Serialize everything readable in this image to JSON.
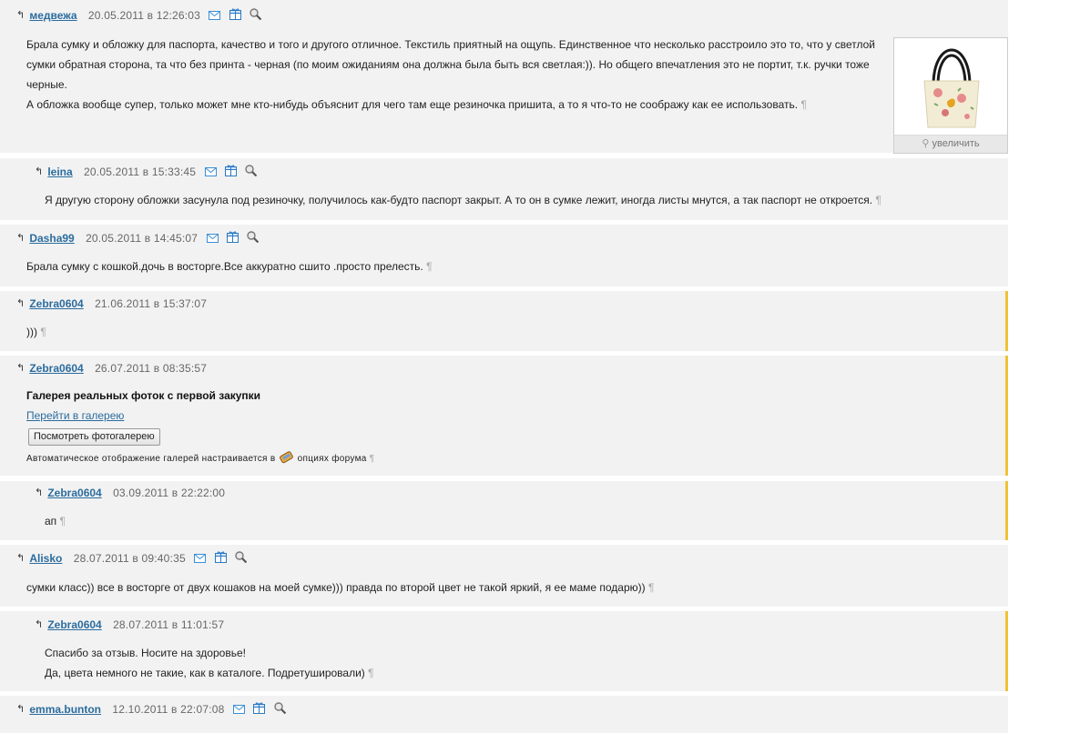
{
  "posts": [
    {
      "author": "медвежа",
      "date": "20.05.2011 в 12:26:03",
      "lines": [
        "Брала сумку и обложку для паспорта, качество и того и другого отличное. Текстиль приятный на ощупь. Единственное что несколько расстроило это то, что у светлой",
        "сумки обратная сторона, та что без принта - черная (по моим ожиданиям она должна была быть вся светлая:)). Но общего впечатления это не портит, т.к. ручки тоже",
        "черные.",
        "А обложка вообще супер, только может мне кто-нибудь объяснит для чего там еще резиночка пришита, а то я что-то не соображу как ее использовать."
      ],
      "zoom_label": "увеличить"
    },
    {
      "author": "leina",
      "date": "20.05.2011 в 15:33:45",
      "lines": [
        "Я другую сторону обложки засунула под резиночку, получилось как-будто паспорт закрыт. А то он в сумке лежит, иногда листы мнутся, а так паспорт не откроется."
      ]
    },
    {
      "author": "Dasha99",
      "date": "20.05.2011 в 14:45:07",
      "lines": [
        "Брала сумку с кошкой.дочь в восторге.Все аккуратно сшито .просто прелесть."
      ]
    },
    {
      "author": "Zebra0604",
      "date": "21.06.2011 в 15:37:07",
      "lines": [
        ")))"
      ]
    },
    {
      "author": "Zebra0604",
      "date": "26.07.2011 в 08:35:57",
      "gallery_title": "Галерея реальных фоток с первой закупки",
      "gallery_link": "Перейти в галерею",
      "gallery_button": "Посмотреть фотогалерею",
      "gallery_note_a": "Автоматическое отображение галерей настраивается в",
      "gallery_note_b": "опциях форума"
    },
    {
      "author": "Zebra0604",
      "date": "03.09.2011 в 22:22:00",
      "lines": [
        "ап"
      ]
    },
    {
      "author": "Alisko",
      "date": "28.07.2011 в 09:40:35",
      "lines": [
        "сумки класс)) все в восторге от двух кошаков на моей сумке))) правда по второй цвет не такой яркий, я ее маме подарю))"
      ]
    },
    {
      "author": "Zebra0604",
      "date": "28.07.2011 в 11:01:57",
      "lines": [
        "Спасибо за отзыв. Носите на здоровье!",
        "Да, цвета немного не такие, как в каталоге. Подретушировали)"
      ]
    },
    {
      "author": "emma.bunton",
      "date": "12.10.2011 в 22:07:08",
      "lines": []
    }
  ],
  "pilcrow": "¶",
  "reply_arrow": "↰",
  "colors": {
    "link": "#2a6c9e",
    "marker": "#f1c232",
    "post_bg": "#f2f2f2"
  }
}
